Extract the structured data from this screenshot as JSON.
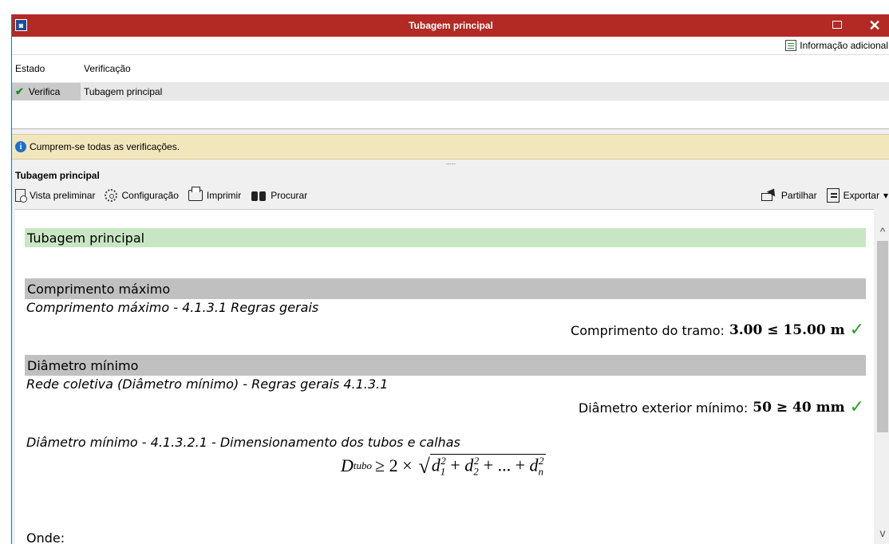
{
  "window": {
    "title": "Tubagem principal",
    "maximize_glyph": "□",
    "close_glyph": "✕"
  },
  "info_button": {
    "label": "Informação adicional",
    "icon": "info-doc-icon"
  },
  "grid": {
    "headers": [
      "Estado",
      "Verificação"
    ],
    "rows": [
      {
        "status": "Verifica",
        "check": "✔",
        "verification": "Tubagem principal"
      }
    ]
  },
  "message": {
    "icon": "info-icon",
    "icon_glyph": "i",
    "text": "Cumprem-se todas as verificações."
  },
  "splitter": {
    "glyph": "....."
  },
  "section": {
    "title": "Tubagem principal"
  },
  "toolbar": {
    "preview": "Vista preliminar",
    "config": "Configuração",
    "print": "Imprimir",
    "search": "Procurar",
    "share": "Partilhar",
    "export": "Exportar",
    "export_caret": "▾"
  },
  "report": {
    "header": "Tubagem principal",
    "section1": {
      "title": "Comprimento máximo",
      "rule": "Comprimento máximo - 4.1.3.1 Regras gerais",
      "check_label": "Comprimento do tramo:",
      "check_value": "3.00 ≤ 15.00 m",
      "check_mark": "✓"
    },
    "section2": {
      "title": "Diâmetro mínimo",
      "rule": "Rede coletiva (Diâmetro mínimo) - Regras gerais 4.1.3.1",
      "check_label": "Diâmetro exterior mínimo:",
      "check_value": "50 ≥ 40 mm",
      "check_mark": "✓",
      "rule2": "Diâmetro mínimo - 4.1.3.2.1 - Dimensionamento dos tubos e calhas",
      "formula": {
        "lhs": "D",
        "lhs_sub": "tubo",
        "op": "≥ 2 ×",
        "terms": [
          "d",
          "1",
          "2",
          "+",
          "d",
          "2",
          "2",
          "+ ... +",
          "d",
          "n",
          "2"
        ]
      }
    },
    "footer": "Onde:"
  },
  "scrollbar": {
    "up": "^",
    "down": "v"
  },
  "colors": {
    "titlebar": "#b22a23",
    "message_bg": "#f2e7bc",
    "header_green": "#c8e6c3",
    "section_grey": "#c0c0c0",
    "check_green": "#2aa02a"
  }
}
